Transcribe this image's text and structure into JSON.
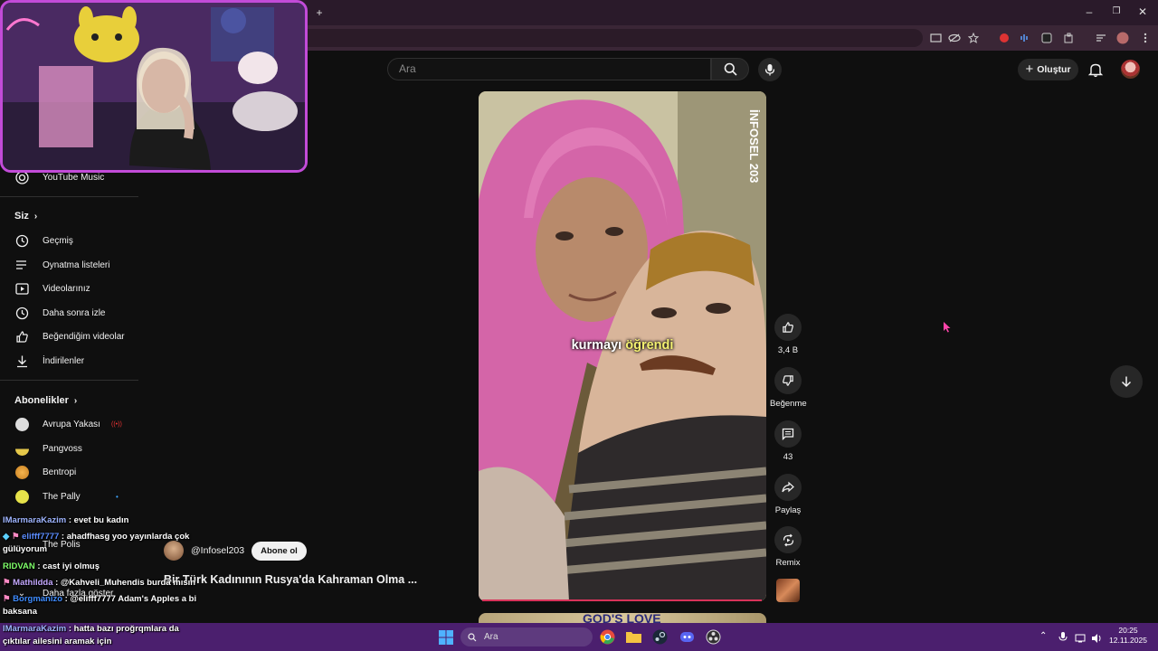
{
  "window": {
    "new_tab_glyph": "+",
    "minimize_glyph": "–",
    "restore_glyph": "❐",
    "close_glyph": "✕"
  },
  "header": {
    "search_placeholder": "Ara",
    "create_label": "Oluştur"
  },
  "sidebar": {
    "music_label": "YouTube Music",
    "you_section": "Siz",
    "you_items": [
      {
        "label": "Geçmiş",
        "icon": "history-icon"
      },
      {
        "label": "Oynatma listeleri",
        "icon": "playlist-icon"
      },
      {
        "label": "Videolarınız",
        "icon": "your-videos-icon"
      },
      {
        "label": "Daha sonra izle",
        "icon": "watch-later-icon"
      },
      {
        "label": "Beğendiğim videolar",
        "icon": "liked-icon"
      },
      {
        "label": "İndirilenler",
        "icon": "download-icon"
      }
    ],
    "subs_section": "Abonelikler",
    "subscriptions": [
      {
        "label": "Avrupa Yakası",
        "live": "((•))"
      },
      {
        "label": "Pangvoss"
      },
      {
        "label": "Bentropi"
      },
      {
        "label": "The Pally",
        "dot": "•"
      },
      {
        "label": "The Polis"
      },
      {
        "label": "Daha fazla göster"
      }
    ]
  },
  "video": {
    "watermark": "İNFOSEL 203",
    "caption_word1": "kurmayı",
    "caption_word2": "öğrendi",
    "next_preview_text": "GOD'S LOVE",
    "channel_handle": "@Infosel203",
    "subscribe_label": "Abone ol",
    "title": "Bir Türk Kadınının Rusya'da Kahraman Olma ...",
    "progress": 0.98
  },
  "actions": {
    "like_count": "3,4 B",
    "dislike_label": "Beğenme",
    "comment_count": "43",
    "share_label": "Paylaş",
    "remix_label": "Remix"
  },
  "chat": [
    {
      "user": "IMarmaraKazim",
      "text": " : evet bu kadın",
      "color": "#9fb5ff"
    },
    {
      "user": "elifff7777",
      "text": " : ahadfhasg yoo yayınlarda çok gülüyorum",
      "color": "#5b8dff"
    },
    {
      "user": "RIDVAN",
      "text": " : cast iyi olmuş",
      "color": "#7fff6a"
    },
    {
      "user": "Mathildda",
      "text": " : @Kahveli_Muhendis burda mısın",
      "color": "#c4a8ff"
    },
    {
      "user": "Borgmanizo",
      "text": " : @elifff7777 Adam's Apples a bi baksana",
      "color": "#3f8cff"
    },
    {
      "user": "IMarmaraKazim",
      "text": " : hatta bazı proğrqmlara da çıktılar ailesini aramak için",
      "color": "#9fb5ff"
    }
  ],
  "taskbar": {
    "search_label": "Ara",
    "time": "20:25",
    "date": "12.11.2025"
  }
}
